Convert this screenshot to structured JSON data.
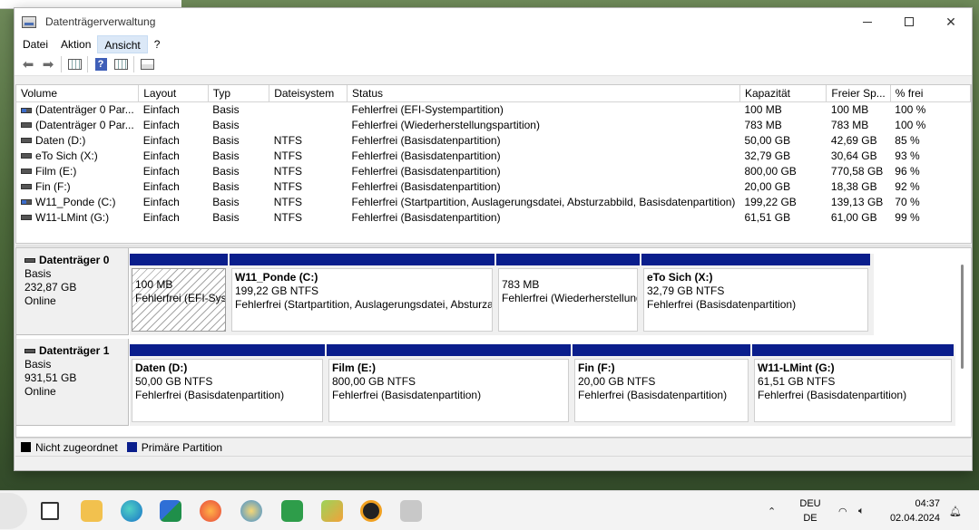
{
  "window": {
    "title": "Datenträgerverwaltung"
  },
  "menu": [
    "Datei",
    "Aktion",
    "Ansicht",
    "?"
  ],
  "table": {
    "columns": [
      "Volume",
      "Layout",
      "Typ",
      "Dateisystem",
      "Status",
      "Kapazität",
      "Freier Sp...",
      "% frei"
    ],
    "rows": [
      [
        "(Datenträger 0 Par...",
        "Einfach",
        "Basis",
        "",
        "Fehlerfrei (EFI-Systempartition)",
        "100 MB",
        "100 MB",
        "100 %"
      ],
      [
        "(Datenträger 0 Par...",
        "Einfach",
        "Basis",
        "",
        "Fehlerfrei (Wiederherstellungspartition)",
        "783 MB",
        "783 MB",
        "100 %"
      ],
      [
        "Daten (D:)",
        "Einfach",
        "Basis",
        "NTFS",
        "Fehlerfrei (Basisdatenpartition)",
        "50,00 GB",
        "42,69 GB",
        "85 %"
      ],
      [
        "eTo Sich (X:)",
        "Einfach",
        "Basis",
        "NTFS",
        "Fehlerfrei (Basisdatenpartition)",
        "32,79 GB",
        "30,64 GB",
        "93 %"
      ],
      [
        "Film (E:)",
        "Einfach",
        "Basis",
        "NTFS",
        "Fehlerfrei (Basisdatenpartition)",
        "800,00 GB",
        "770,58 GB",
        "96 %"
      ],
      [
        "Fin (F:)",
        "Einfach",
        "Basis",
        "NTFS",
        "Fehlerfrei (Basisdatenpartition)",
        "20,00 GB",
        "18,38 GB",
        "92 %"
      ],
      [
        "W11_Ponde (C:)",
        "Einfach",
        "Basis",
        "NTFS",
        "Fehlerfrei (Startpartition, Auslagerungsdatei, Absturzabbild, Basisdatenpartition)",
        "199,22 GB",
        "139,13 GB",
        "70 %"
      ],
      [
        "W11-LMint (G:)",
        "Einfach",
        "Basis",
        "NTFS",
        "Fehlerfrei (Basisdatenpartition)",
        "61,51 GB",
        "61,00 GB",
        "99 %"
      ]
    ]
  },
  "disks": [
    {
      "name": "Datenträger 0",
      "type": "Basis",
      "size": "232,87 GB",
      "state": "Online",
      "partitions": [
        {
          "name": "",
          "size": "100 MB",
          "status": "Fehlerfrei (EFI-Systempartition)"
        },
        {
          "name": "W11_Ponde  (C:)",
          "size": "199,22 GB NTFS",
          "status": "Fehlerfrei (Startpartition, Auslagerungsdatei, Absturzabbild, Basisdatenpartition)"
        },
        {
          "name": "",
          "size": "783 MB",
          "status": "Fehlerfrei (Wiederherstellungspartition)"
        },
        {
          "name": "eTo Sich  (X:)",
          "size": "32,79 GB NTFS",
          "status": "Fehlerfrei (Basisdatenpartition)"
        }
      ]
    },
    {
      "name": "Datenträger 1",
      "type": "Basis",
      "size": "931,51 GB",
      "state": "Online",
      "partitions": [
        {
          "name": "Daten  (D:)",
          "size": "50,00 GB NTFS",
          "status": "Fehlerfrei (Basisdatenpartition)"
        },
        {
          "name": "Film  (E:)",
          "size": "800,00 GB NTFS",
          "status": "Fehlerfrei (Basisdatenpartition)"
        },
        {
          "name": "Fin  (F:)",
          "size": "20,00 GB NTFS",
          "status": "Fehlerfrei (Basisdatenpartition)"
        },
        {
          "name": "W11-LMint  (G:)",
          "size": "61,51 GB NTFS",
          "status": "Fehlerfrei (Basisdatenpartition)"
        }
      ]
    }
  ],
  "legend": [
    {
      "label": "Nicht zugeordnet",
      "color": "#000000"
    },
    {
      "label": "Primäre Partition",
      "color": "#0a1e8c"
    }
  ],
  "taskbar": {
    "lang_top": "DEU",
    "lang_bottom": "DE",
    "time": "04:37",
    "date": "02.04.2024"
  }
}
